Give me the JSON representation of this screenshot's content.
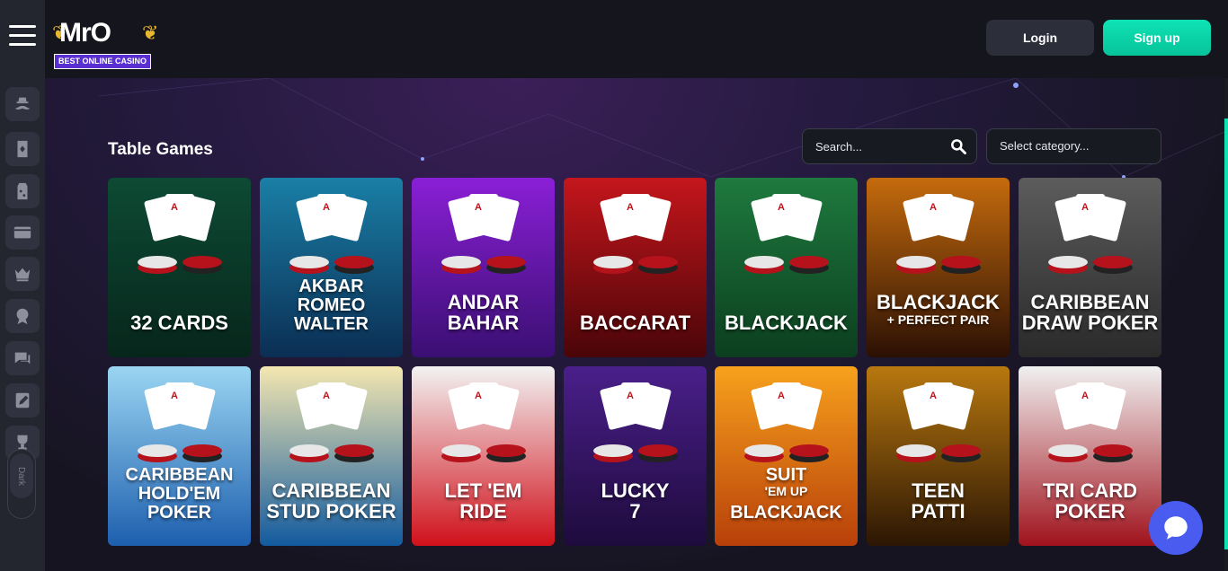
{
  "header": {
    "logo_text": "MrO",
    "logo_tagline": "BEST ONLINE CASINO",
    "login_label": "Login",
    "signup_label": "Sign up"
  },
  "sidebar": {
    "items": [
      "mustache-icon",
      "card-icon",
      "percent-tag-icon",
      "credit-card-icon",
      "crown-icon",
      "award-icon",
      "chat-bubbles-icon",
      "edit-note-icon",
      "trophy-icon"
    ],
    "theme_label": "Dark"
  },
  "main": {
    "title": "Table Games",
    "search": {
      "placeholder": "Search..."
    },
    "category_placeholder": "Select category..."
  },
  "games": [
    {
      "line1": "32 CARDS",
      "line2": "",
      "line3": "",
      "colors": [
        "#0d4a34",
        "#07261b"
      ]
    },
    {
      "line1": "AKBAR",
      "line2": "ROMEO",
      "line3": "WALTER",
      "colors": [
        "#1a7fa6",
        "#0b2e54"
      ]
    },
    {
      "line1": "ANDAR",
      "line2": "BAHAR",
      "line3": "",
      "colors": [
        "#8a1fd6",
        "#3a0f72"
      ]
    },
    {
      "line1": "BACCARAT",
      "line2": "",
      "line3": "",
      "colors": [
        "#c4161c",
        "#4a0508"
      ]
    },
    {
      "line1": "BLACKJACK",
      "line2": "",
      "line3": "",
      "colors": [
        "#1e7a3e",
        "#0c3e1f"
      ]
    },
    {
      "line1": "BLACKJACK",
      "line2": "+ PERFECT PAIR",
      "line3": "",
      "colors": [
        "#c56b0d",
        "#2b1004"
      ]
    },
    {
      "line1": "CARIBBEAN",
      "line2": "DRAW POKER",
      "line3": "",
      "colors": [
        "#5c5c5c",
        "#2a2a2a"
      ]
    },
    {
      "line1": "CARIBBEAN",
      "line2": "HOLD'EM",
      "line3": "POKER",
      "colors": [
        "#9ad5f2",
        "#1d5fae"
      ]
    },
    {
      "line1": "CARIBBEAN",
      "line2": "STUD POKER",
      "line3": "",
      "colors": [
        "#f4e7b0",
        "#125a9e"
      ]
    },
    {
      "line1": "LET 'EM",
      "line2": "RIDE",
      "line3": "",
      "colors": [
        "#f2f2f2",
        "#d0101a"
      ]
    },
    {
      "line1": "LUCKY",
      "line2": "7",
      "line3": "",
      "colors": [
        "#4a1f8a",
        "#1e0b3c"
      ]
    },
    {
      "line1": "SUIT",
      "line2": "'EM UP",
      "line3": "BLACKJACK",
      "colors": [
        "#f7a11c",
        "#b8400a"
      ]
    },
    {
      "line1": "TEEN",
      "line2": "PATTI",
      "line3": "",
      "colors": [
        "#b8780f",
        "#2b1604"
      ]
    },
    {
      "line1": "TRI CARD",
      "line2": "POKER",
      "line3": "",
      "colors": [
        "#f0f0f0",
        "#a0121c"
      ]
    }
  ],
  "chat_icon": "chat-widget-icon"
}
